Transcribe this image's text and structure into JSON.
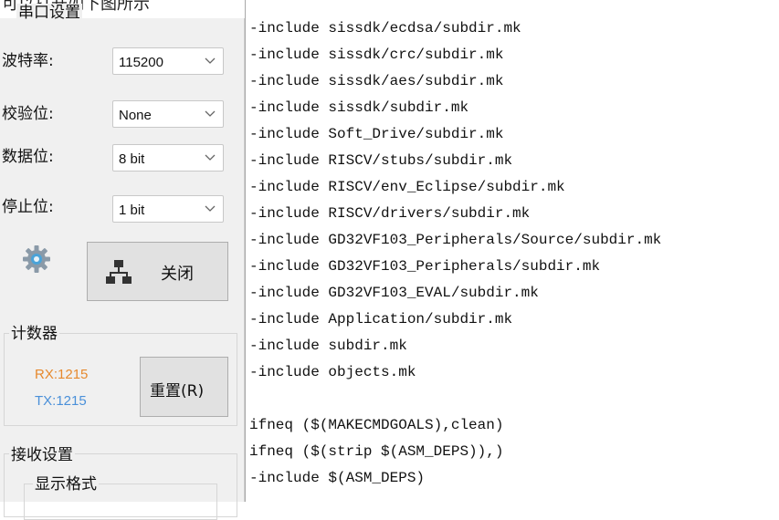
{
  "top_strip": {
    "text": "可以打开如下图所示"
  },
  "serial_settings": {
    "group_title": "串口设置",
    "rows": [
      {
        "label": "波特率:",
        "value": "115200"
      },
      {
        "label": "校验位:",
        "value": "None"
      },
      {
        "label": "数据位:",
        "value": "8 bit"
      },
      {
        "label": "停止位:",
        "value": "1 bit"
      }
    ],
    "open_button_label": "关闭"
  },
  "counter": {
    "group_title": "计数器",
    "rx": "RX:1215",
    "tx": "TX:1215",
    "reset_label": "重置(R)"
  },
  "receive_settings": {
    "group_title": "接收设置",
    "display_format_title": "显示格式"
  },
  "editor": {
    "lines": [
      "-include sissdk/ecdsa/subdir.mk",
      "-include sissdk/crc/subdir.mk",
      "-include sissdk/aes/subdir.mk",
      "-include sissdk/subdir.mk",
      "-include Soft_Drive/subdir.mk",
      "-include RISCV/stubs/subdir.mk",
      "-include RISCV/env_Eclipse/subdir.mk",
      "-include RISCV/drivers/subdir.mk",
      "-include GD32VF103_Peripherals/Source/subdir.mk",
      "-include GD32VF103_Peripherals/subdir.mk",
      "-include GD32VF103_EVAL/subdir.mk",
      "-include Application/subdir.mk",
      "-include subdir.mk",
      "-include objects.mk",
      "",
      "ifneq ($(MAKECMDGOALS),clean)",
      "ifneq ($(strip $(ASM_DEPS)),)",
      "-include $(ASM_DEPS)"
    ]
  },
  "icons": [
    "gear-icon",
    "network-icon",
    "chevron-down-icon"
  ],
  "colors": {
    "rx": "#e6892e",
    "tx": "#4a90d9"
  }
}
